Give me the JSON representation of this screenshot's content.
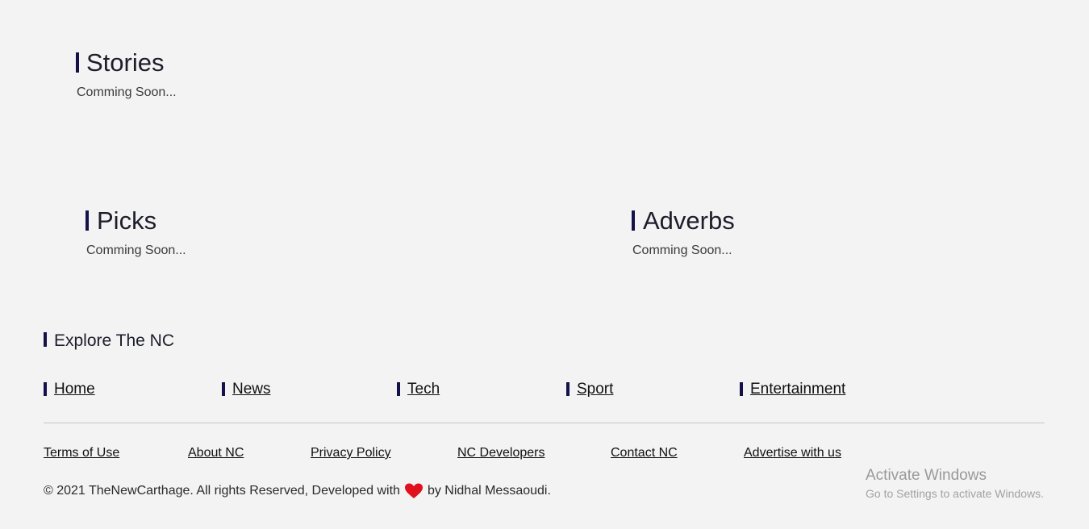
{
  "sections": {
    "stories": {
      "title": "Stories",
      "status": "Comming Soon..."
    },
    "picks": {
      "title": "Picks",
      "status": "Comming Soon..."
    },
    "adverbs": {
      "title": "Adverbs",
      "status": "Comming Soon..."
    }
  },
  "explore": {
    "title": "Explore The NC",
    "links": [
      "Home",
      "News",
      "Tech",
      "Sport",
      "Entertainment"
    ]
  },
  "footer": {
    "links": [
      "Terms of Use",
      "About NC",
      "Privacy Policy",
      "NC Developers",
      "Contact NC",
      "Advertise with us"
    ],
    "copyright_before": "© 2021 TheNewCarthage. All rights Reserved, Developed with",
    "copyright_after": "by Nidhal Messaoudi.",
    "heart_icon": "heart-icon",
    "heart_color": "#e0101e"
  },
  "colors": {
    "accent_bar": "#14104a",
    "background": "#f3f3f3"
  },
  "windows_watermark": {
    "title": "Activate Windows",
    "subtitle": "Go to Settings to activate Windows."
  }
}
